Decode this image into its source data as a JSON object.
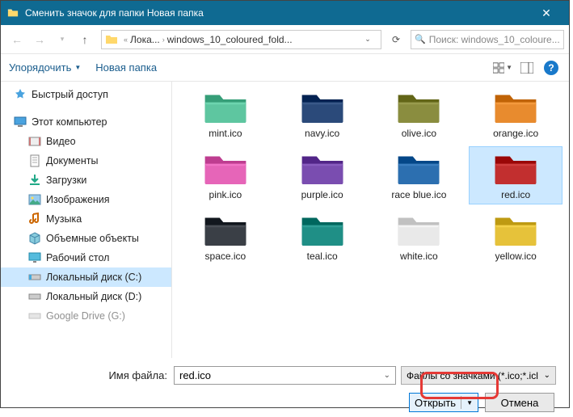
{
  "title": "Сменить значок для папки Новая папка",
  "nav": {
    "crumb1": "Лока...",
    "crumb2": "windows_10_coloured_fold...",
    "searchPlaceholder": "Поиск: windows_10_coloure..."
  },
  "toolbar": {
    "organize": "Упорядочить",
    "newFolder": "Новая папка"
  },
  "sidebar": {
    "quickAccess": "Быстрый доступ",
    "thisPC": "Этот компьютер",
    "items": [
      "Видео",
      "Документы",
      "Загрузки",
      "Изображения",
      "Музыка",
      "Объемные объекты",
      "Рабочий стол",
      "Локальный диск (C:)",
      "Локальный диск (D:)",
      "Google Drive (G:)"
    ]
  },
  "files": [
    {
      "label": "mint.ico",
      "color": "#5ec6a0"
    },
    {
      "label": "navy.ico",
      "color": "#2b4a7a"
    },
    {
      "label": "olive.ico",
      "color": "#8a8d3f"
    },
    {
      "label": "orange.ico",
      "color": "#e88b2e"
    },
    {
      "label": "pink.ico",
      "color": "#e665b8"
    },
    {
      "label": "purple.ico",
      "color": "#7a4db0"
    },
    {
      "label": "race blue.ico",
      "color": "#2c6fb0"
    },
    {
      "label": "red.ico",
      "color": "#c22f2f",
      "selected": true
    },
    {
      "label": "space.ico",
      "color": "#3a3f46"
    },
    {
      "label": "teal.ico",
      "color": "#1f8f86"
    },
    {
      "label": "white.ico",
      "color": "#e9e9e9"
    },
    {
      "label": "yellow.ico",
      "color": "#e6c23a"
    }
  ],
  "footer": {
    "fileNameLabel": "Имя файла:",
    "fileNameValue": "red.ico",
    "filterLabel": "Файлы со значками (*.ico;*.icl",
    "open": "Открыть",
    "cancel": "Отмена"
  }
}
